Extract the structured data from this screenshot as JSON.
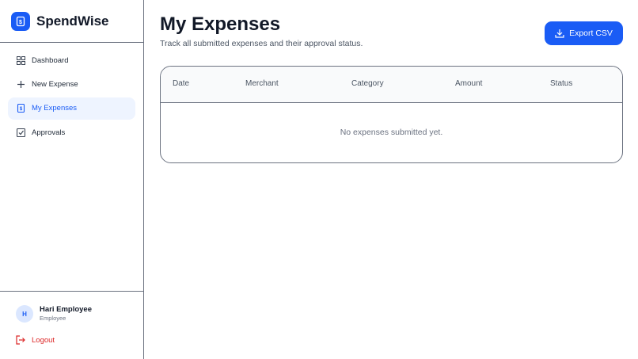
{
  "brand": {
    "name": "SpendWise",
    "logo_icon": "receipt-dollar-icon",
    "accent": "#1a5cf5"
  },
  "sidebar": {
    "items": [
      {
        "label": "Dashboard",
        "icon": "grid-icon",
        "active": false
      },
      {
        "label": "New Expense",
        "icon": "plus-icon",
        "active": false
      },
      {
        "label": "My Expenses",
        "icon": "receipt-icon",
        "active": true
      },
      {
        "label": "Approvals",
        "icon": "checkbox-icon",
        "active": false
      }
    ]
  },
  "user": {
    "initial": "H",
    "name": "Hari Employee",
    "role": "Employee"
  },
  "logout": {
    "label": "Logout",
    "icon": "logout-icon",
    "color": "#dc2626"
  },
  "page": {
    "title": "My Expenses",
    "subtitle": "Track all submitted expenses and their approval status."
  },
  "export": {
    "label": "Export CSV",
    "icon": "download-icon"
  },
  "table": {
    "columns": [
      "Date",
      "Merchant",
      "Category",
      "Amount",
      "Status"
    ],
    "empty_message": "No expenses submitted yet."
  }
}
